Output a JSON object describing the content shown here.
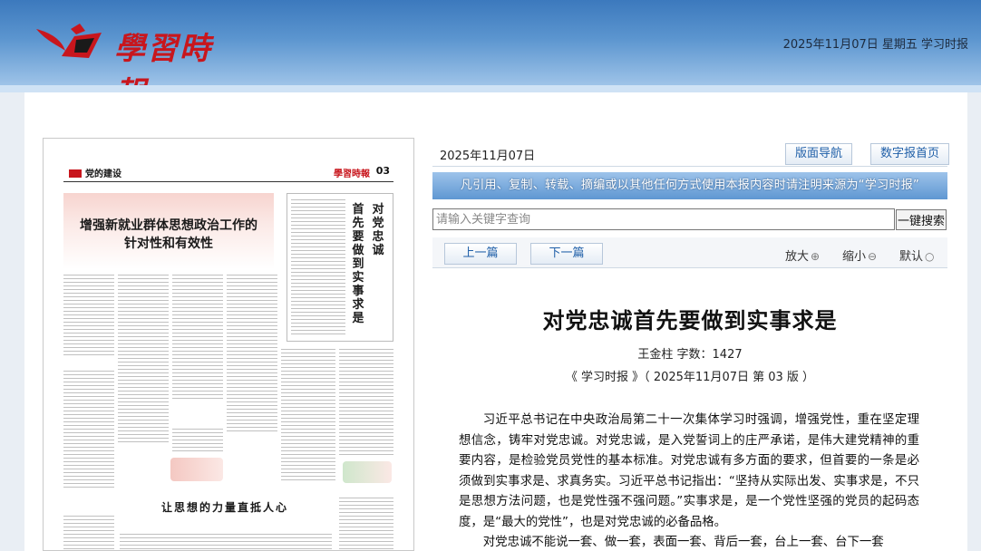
{
  "header": {
    "logo_text": "學習時報",
    "date_text": "2025年11月07日 星期五 学习时报",
    "colors": {
      "header_top": "#3c79bd",
      "header_bottom": "#9ec3e8",
      "logo_red": "#c8161d"
    }
  },
  "paper": {
    "section_label": "党的建设",
    "page_no": "03",
    "mini_logo": "學習時報",
    "headline_line1": "增强新就业群体思想政治工作的",
    "headline_line2": "针对性和有效性",
    "vertical_title_col1": "对党忠诚",
    "vertical_title_col2": "首先要做到实事求是",
    "bottom_title": "让思想的力量直抵人心"
  },
  "toolbar": {
    "current_date": "2025年11月07日",
    "layout_nav": "版面导航",
    "digital_home": "数字报首页",
    "notice": "凡引用、复制、转载、摘编或以其他任何方式使用本报内容时请注明来源为“学习时报”",
    "search_placeholder": "请输入关键字查询",
    "search_button": "一键搜索",
    "prev_article": "上一篇",
    "next_article": "下一篇",
    "zoom_in": "放大",
    "zoom_out": "缩小",
    "zoom_default": "默认"
  },
  "article": {
    "title": "对党忠诚首先要做到实事求是",
    "byline": "王金柱 字数：1427",
    "source": "《 学习时报 》（ 2025年11月07日 第 03 版 ）",
    "paragraph1": "习近平总书记在中央政治局第二十一次集体学习时强调，增强党性，重在坚定理想信念，铸牢对党忠诚。对党忠诚，是入党誓词上的庄严承诺，是伟大建党精神的重要内容，是检验党员党性的基本标准。对党忠诚有多方面的要求，但首要的一条是必须做到实事求是、求真务实。习近平总书记指出：“坚持从实际出发、实事求是，不只是思想方法问题，也是党性强不强问题。”实事求是，是一个党性坚强的党员的起码态度，是“最大的党性”，也是对党忠诚的必备品格。",
    "paragraph2": "对党忠诚不能说一套、做一套，表面一套、背后一套，台上一套、台下一套"
  }
}
